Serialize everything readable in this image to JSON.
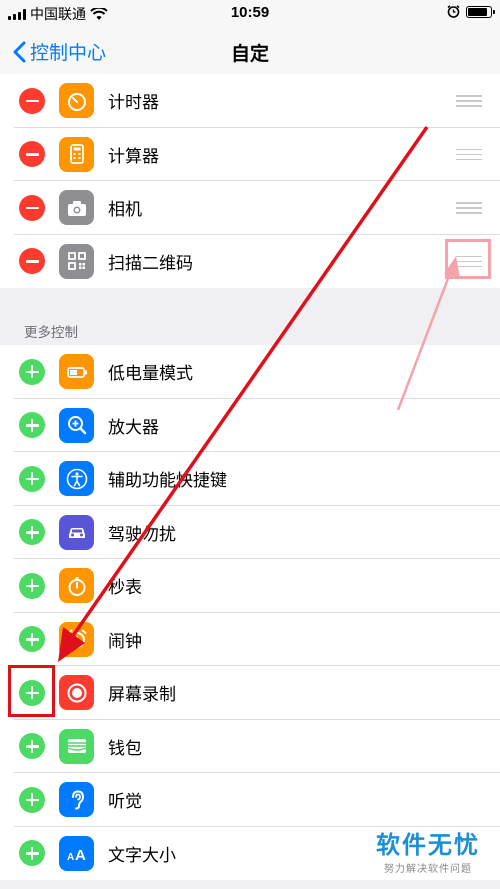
{
  "status": {
    "carrier": "中国联通",
    "time": "10:59",
    "battery_level": 0.85
  },
  "nav": {
    "back_label": "控制中心",
    "title": "自定"
  },
  "included": [
    {
      "label": "计时器",
      "icon": "timer-icon",
      "color": "#ff9500"
    },
    {
      "label": "计算器",
      "icon": "calculator-icon",
      "color": "#ff9500"
    },
    {
      "label": "相机",
      "icon": "camera-icon",
      "color": "#8e8e93"
    },
    {
      "label": "扫描二维码",
      "icon": "qr-code-icon",
      "color": "#8e8e93"
    }
  ],
  "section_header": "更多控制",
  "more_controls": [
    {
      "label": "低电量模式",
      "icon": "low-power-icon",
      "color": "#ff9500"
    },
    {
      "label": "放大器",
      "icon": "magnifier-icon",
      "color": "#007aff"
    },
    {
      "label": "辅助功能快捷键",
      "icon": "accessibility-icon",
      "color": "#007aff"
    },
    {
      "label": "驾驶勿扰",
      "icon": "car-icon",
      "color": "#5856d6"
    },
    {
      "label": "秒表",
      "icon": "stopwatch-icon",
      "color": "#ff9500"
    },
    {
      "label": "闹钟",
      "icon": "alarm-icon",
      "color": "#ff9500"
    },
    {
      "label": "屏幕录制",
      "icon": "screen-record-icon",
      "color": "#ff3b30"
    },
    {
      "label": "钱包",
      "icon": "wallet-icon",
      "color": "#4cd964"
    },
    {
      "label": "听觉",
      "icon": "hearing-icon",
      "color": "#007aff"
    },
    {
      "label": "文字大小",
      "icon": "text-size-icon",
      "color": "#007aff"
    }
  ],
  "watermark": {
    "title": "软件无忧",
    "subtitle": "努力解决软件问题"
  },
  "colors": {
    "accent": "#007aff",
    "remove": "#ff3b30",
    "add": "#4cd964",
    "annotation": "#e0101a",
    "annotation_light": "#f4a3a8"
  }
}
